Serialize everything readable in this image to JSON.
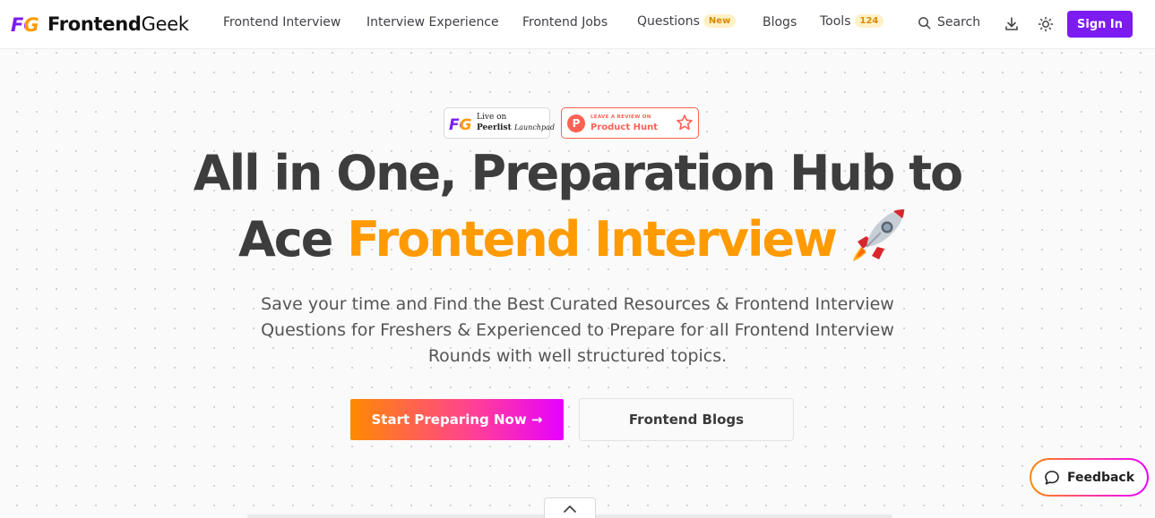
{
  "logo": {
    "mark": "FG",
    "name_bold": "Frontend",
    "name_regular": "Geek"
  },
  "nav": {
    "frontend_interview": "Frontend Interview",
    "interview_experience": "Interview Experience",
    "frontend_jobs": "Frontend Jobs",
    "questions": "Questions",
    "questions_badge": "New",
    "blogs": "Blogs",
    "tools": "Tools",
    "tools_badge": "124",
    "search": "Search",
    "signin": "Sign In"
  },
  "launch": {
    "peerlist_line1": "Live on",
    "peerlist_line2": "Peerlist",
    "peerlist_line3": "Launchpad",
    "ph_small": "LEAVE A REVIEW ON",
    "ph_name": "Product Hunt",
    "ph_letter": "P"
  },
  "hero": {
    "line1": "All in One, Preparation Hub to",
    "line2_plain": "Ace",
    "line2_accent": "Frontend Interview",
    "subtitle_lines": [
      "Save your time and Find the Best Curated Resources & Frontend Interview",
      "Questions for Freshers & Experienced to Prepare for all Frontend Interview",
      "Rounds with well structured topics."
    ]
  },
  "cta": {
    "primary": "Start Preparing Now →",
    "secondary": "Frontend Blogs"
  },
  "feedback": {
    "label": "Feedback"
  },
  "colors": {
    "accent": "#ff9a00",
    "brand": "#7c1bf2",
    "heading": "#3d3d3d",
    "ph_red": "#ff6154"
  },
  "icons": {
    "search": "search-icon",
    "download": "download-icon",
    "theme": "sun-icon",
    "rocket": "rocket-icon",
    "star": "star-icon",
    "feedback": "chat-bubble-icon",
    "collapse": "chevron-up-icon"
  }
}
